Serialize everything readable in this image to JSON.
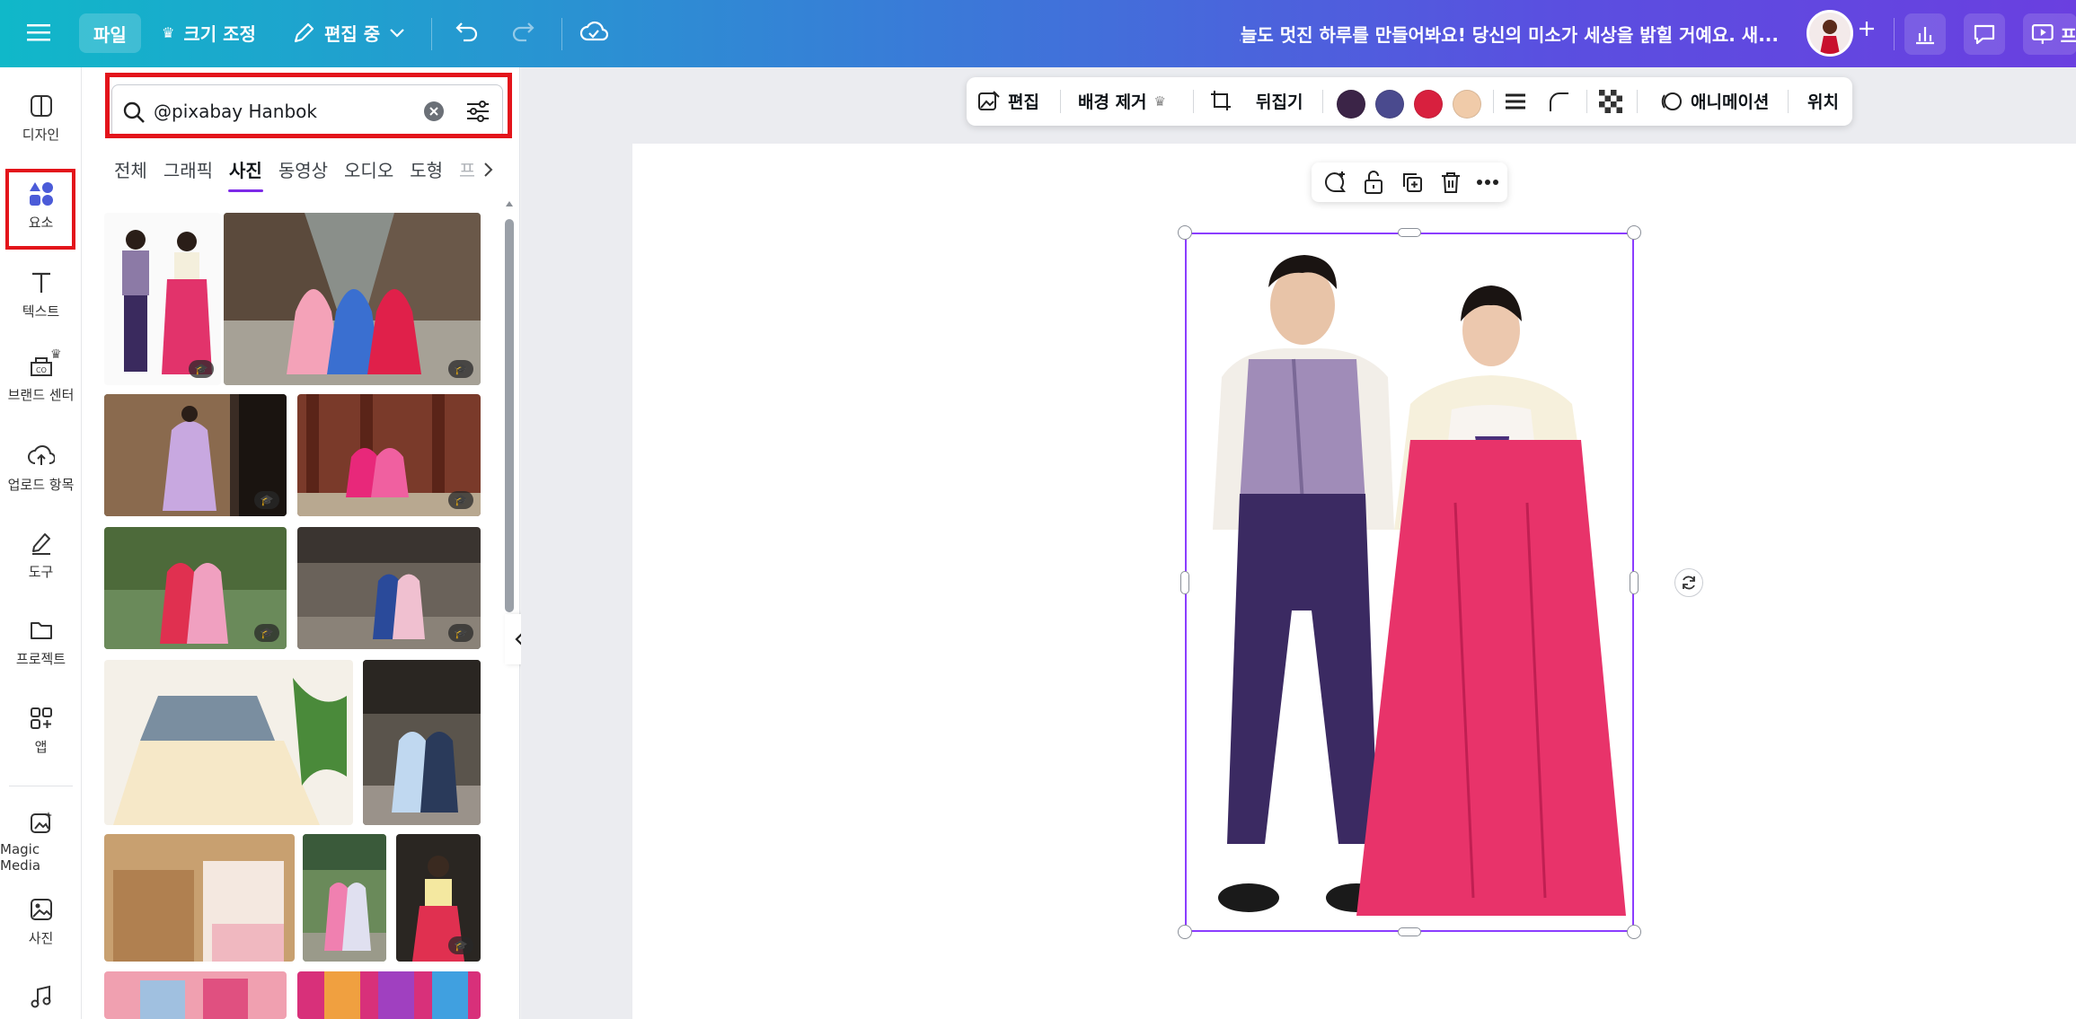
{
  "topbar": {
    "menu_icon": "hamburger-icon",
    "file_label": "파일",
    "resize_label": "크기 조정",
    "edit_mode_label": "편집 중",
    "title": "오늘도 멋진 하루를 만들어봐요! 당신의 미소가 세상을 밝힐 거예요. 새...",
    "present_label": "프"
  },
  "rail": {
    "items": [
      {
        "label": "디자인",
        "icon": "design-icon"
      },
      {
        "label": "요소",
        "icon": "elements-icon"
      },
      {
        "label": "텍스트",
        "icon": "text-icon"
      },
      {
        "label": "브랜드 센터",
        "icon": "brand-icon"
      },
      {
        "label": "업로드 항목",
        "icon": "upload-icon"
      },
      {
        "label": "도구",
        "icon": "draw-icon"
      },
      {
        "label": "프로젝트",
        "icon": "folder-icon"
      },
      {
        "label": "앱",
        "icon": "apps-icon"
      },
      {
        "label": "Magic Media",
        "icon": "magic-media-icon"
      },
      {
        "label": "사진",
        "icon": "photo-icon"
      },
      {
        "label": "",
        "icon": "music-icon"
      }
    ]
  },
  "panel": {
    "search": {
      "value": "@pixabay Hanbok"
    },
    "tabs": [
      "전체",
      "그래픽",
      "사진",
      "동영상",
      "오디오",
      "도형",
      "프"
    ],
    "active_tab": "사진"
  },
  "toolbar": {
    "edit_label": "편집",
    "bg_remove_label": "배경 제거",
    "flip_label": "뒤집기",
    "colors": [
      "#3b2447",
      "#4a4a8e",
      "#d8203e",
      "#f0cba9"
    ],
    "animate_label": "애니메이션",
    "position_label": "위치"
  }
}
